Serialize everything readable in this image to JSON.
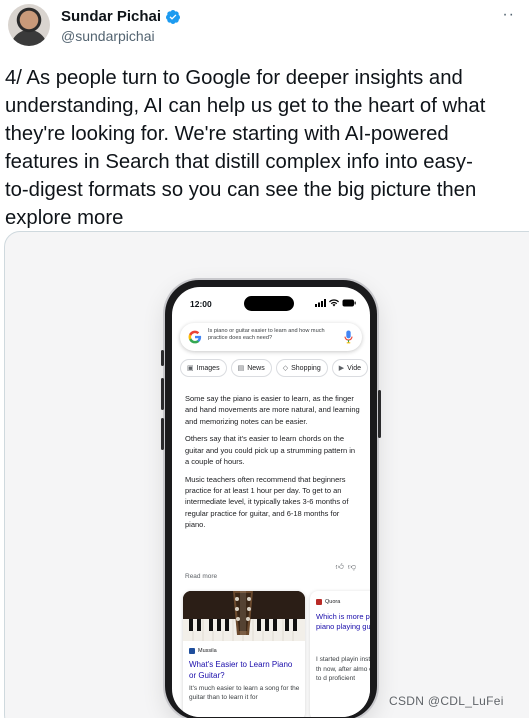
{
  "tweet": {
    "author": {
      "display_name": "Sundar Pichai",
      "handle": "@sundarpichai",
      "verified": true
    },
    "more_icon": "more-dots-icon",
    "text": "4/ As people turn to Google for deeper insights and\nunderstanding, AI can help us get to the heart of what\nthey're looking for. We're starting with AI-powered\nfeatures in Search that distill complex info into easy-\nto-digest formats so you can see the big picture then\nexplore more"
  },
  "phone": {
    "time": "12:00",
    "status_icons": "▐▐▐ ⌇ ▬",
    "search": {
      "query": "Is piano or guitar easier to learn and how much practice does each need?",
      "icons": [
        "google-logo-icon",
        "mic-icon"
      ]
    },
    "chips": [
      {
        "label": "Images",
        "icon": "image-icon"
      },
      {
        "label": "News",
        "icon": "news-icon"
      },
      {
        "label": "Shopping",
        "icon": "tag-icon"
      },
      {
        "label": "Vide",
        "icon": "video-icon"
      }
    ],
    "answer": {
      "paragraphs": [
        "Some say the piano is easier to learn, as the finger and hand movements are more natural, and learning and memorizing notes can be easier.",
        "Others say that it's easier to learn chords on the guitar and you could pick up a strumming pattern in a couple of hours.",
        "Music teachers often recommend that beginners practice for at least 1 hour per day. To get to an intermediate level, it typically takes 3-6 months of regular practice for guitar, and 6-18 months for piano."
      ],
      "read_more": "Read more",
      "feedback_icons": [
        "thumbs-up-icon",
        "thumbs-down-icon"
      ]
    },
    "results": [
      {
        "source": "Mussila",
        "title": "What's Easier to Learn Piano or Guitar?",
        "snippet": "It's much easier to learn a song for the guitar than to learn it for"
      },
      {
        "source": "Quora",
        "title": "Which is more playing piano playing guitar",
        "snippet": "I started playin instruments th now, after almo continue to d proficient"
      }
    ]
  },
  "watermark": "CSDN @CDL_LuFei",
  "colors": {
    "verified": "#1d9bf0",
    "link": "#1a0dab",
    "text": "#0f1419",
    "muted": "#536471"
  }
}
